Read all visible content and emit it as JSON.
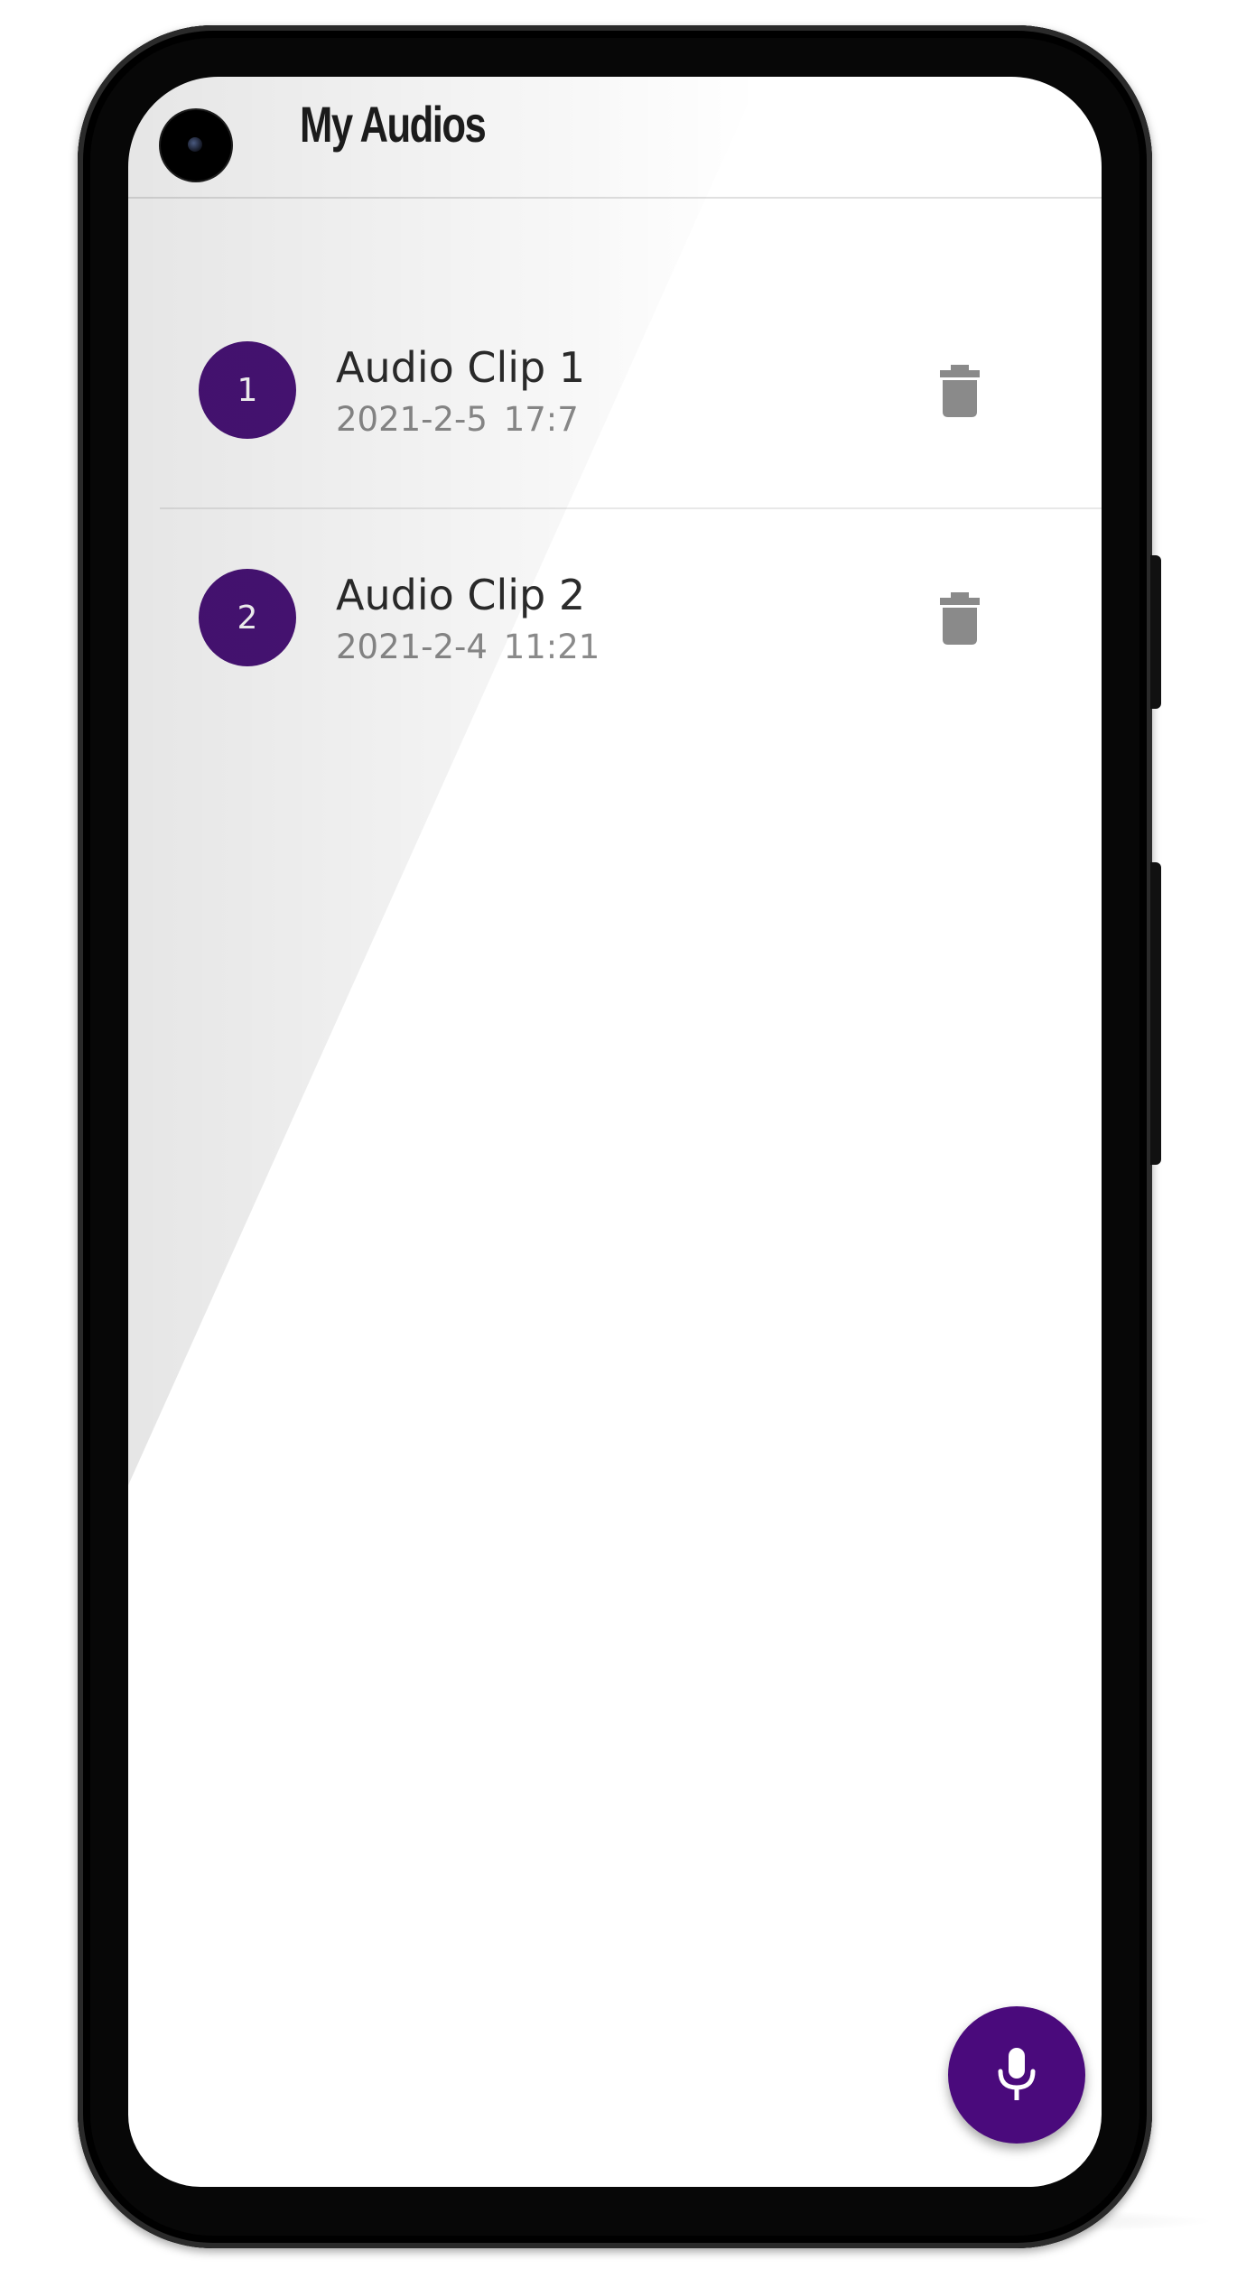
{
  "app_bar": {
    "title": "My Audios"
  },
  "recordings": [
    {
      "index_label": "1",
      "title": "Audio Clip 1",
      "date": "2021-2-5",
      "time": "17:7",
      "delete_icon": "trash-icon"
    },
    {
      "index_label": "2",
      "title": "Audio Clip 2",
      "date": "2021-2-4",
      "time": "11:21",
      "delete_icon": "trash-icon"
    }
  ],
  "fab": {
    "icon": "microphone-icon"
  },
  "colors": {
    "accent": "#491378",
    "fab": "#4a0a7c",
    "title_text": "#2b2b2b",
    "subtitle_text": "#8a8a8a",
    "icon_gray": "#8a8a8a"
  }
}
